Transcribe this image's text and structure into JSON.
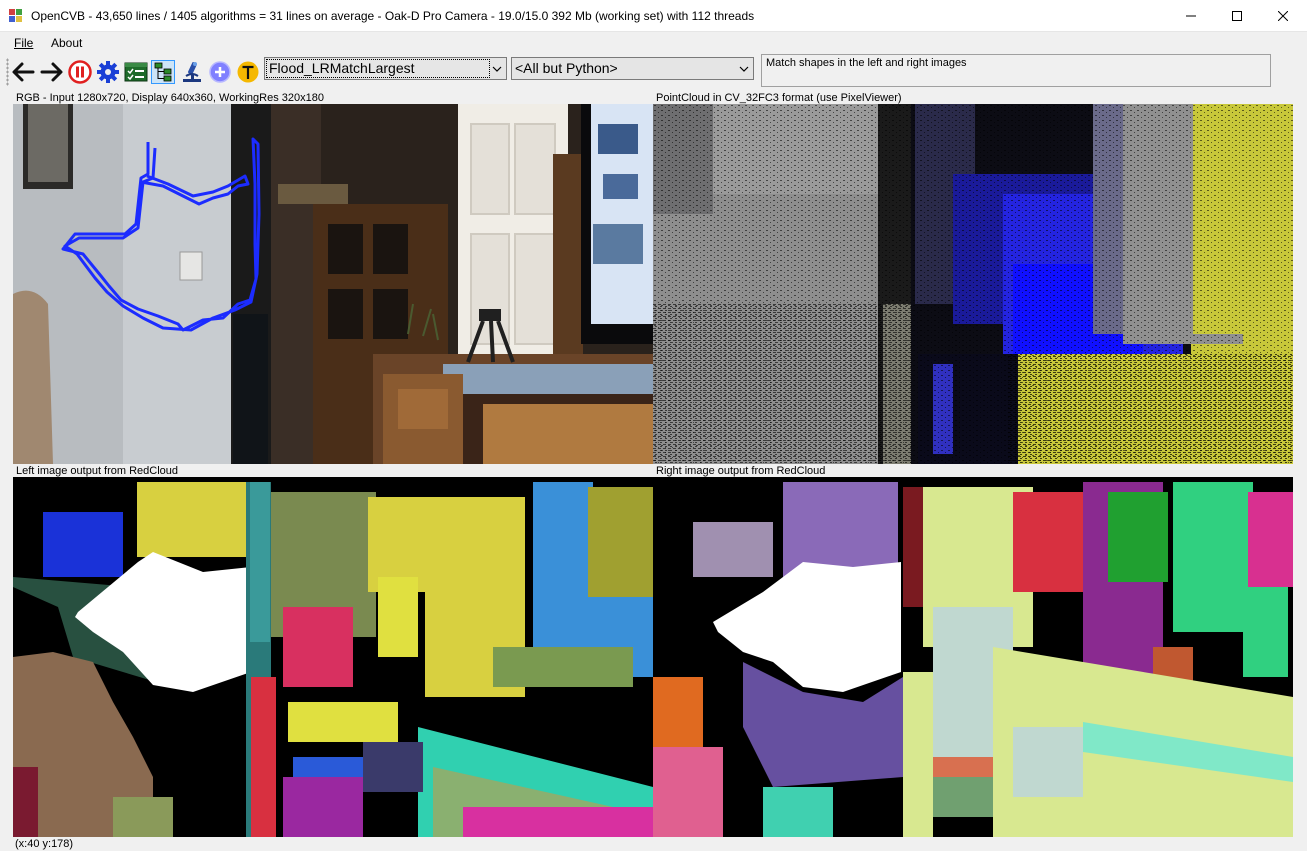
{
  "window": {
    "title": "OpenCVB - 43,650 lines / 1405 algorithms = 31 lines on average - Oak-D Pro Camera - 19.0/15.0 392 Mb (working set) with 112 threads"
  },
  "menu": {
    "file": "File",
    "about": "About"
  },
  "toolbar": {
    "icons": [
      "back-arrow-icon",
      "forward-arrow-icon",
      "pause-icon",
      "gear-icon",
      "test-all-icon",
      "algorithm-tree-icon",
      "microscope-icon",
      "add-plus-icon",
      "translate-t-icon"
    ],
    "algorithm_value": "Flood_LRMatchLargest",
    "group_value": "<All but Python>",
    "description": "Match shapes in the left and right images",
    "colors": {
      "pause_red": "#e02020",
      "gear_blue": "#1a3fd6",
      "plus_purple": "#8080ff",
      "t_yellow": "#f5b800"
    }
  },
  "panels": {
    "top_left_label": "RGB - Input 1280x720, Display 640x360, WorkingRes 320x180",
    "top_right_label": "PointCloud in CV_32FC3 format (use PixelViewer)",
    "bottom_left_label": "Left image output from RedCloud",
    "bottom_right_label": "Right image output from RedCloud"
  },
  "status": {
    "coords": "(x:40 y:178)"
  }
}
